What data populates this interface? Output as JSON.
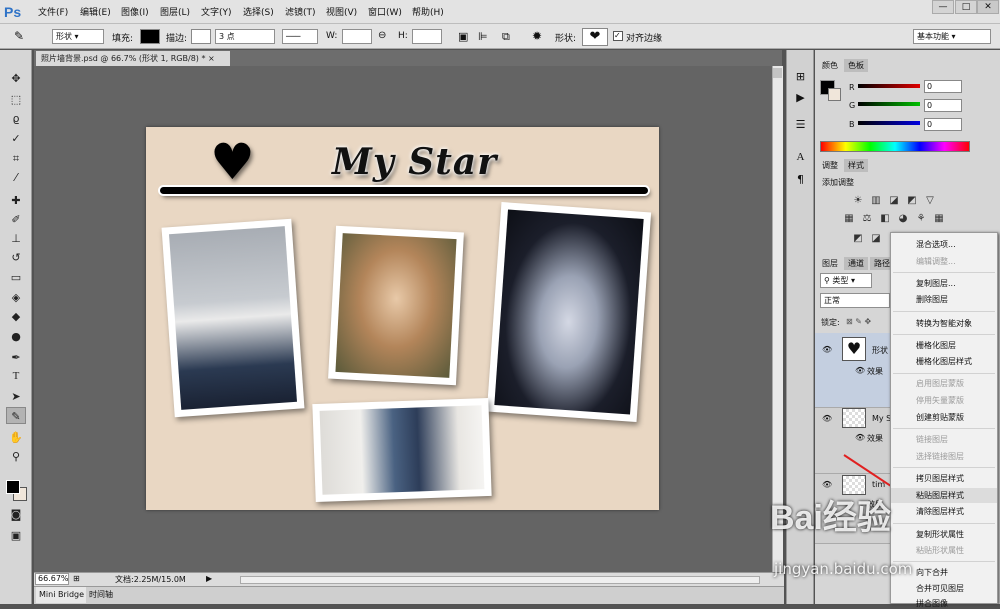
{
  "app": {
    "logo": "Ps",
    "window_controls": [
      "—",
      "□",
      "✕"
    ]
  },
  "menu": [
    "文件(F)",
    "编辑(E)",
    "图像(I)",
    "图层(L)",
    "文字(Y)",
    "选择(S)",
    "滤镜(T)",
    "视图(V)",
    "窗口(W)",
    "帮助(H)"
  ],
  "options": {
    "mode": "形状",
    "fill_label": "填充:",
    "stroke_label": "描边:",
    "stroke_width": "3 点",
    "w_label": "W:",
    "h_label": "H:",
    "shape_label": "形状:",
    "align_edges": "对齐边缘",
    "workspace": "基本功能"
  },
  "document": {
    "tab": "照片墙背景.psd @ 66.7% (形状 1, RGB/8) *",
    "title_text": "My Star",
    "zoom": "66.67%",
    "doc_size": "文档:2.25M/15.0M"
  },
  "bottom_tabs": [
    "Mini Bridge",
    "时间轴"
  ],
  "color_panel": {
    "tabs": [
      "颜色",
      "色板"
    ],
    "channels": [
      {
        "label": "R",
        "value": "0"
      },
      {
        "label": "G",
        "value": "0"
      },
      {
        "label": "B",
        "value": "0"
      }
    ]
  },
  "adjust_panel": {
    "tabs": [
      "调整",
      "样式"
    ],
    "add_label": "添加调整"
  },
  "layers_panel": {
    "tabs": [
      "图层",
      "通道",
      "路径"
    ],
    "filter": "类型",
    "blend": "正常",
    "lock_label": "锁定:",
    "layers": [
      {
        "name": "形状",
        "effect": "效果"
      },
      {
        "name": "My S",
        "effect": "效果"
      },
      {
        "name": "tim",
        "effect": "效果"
      }
    ]
  },
  "context_menu": {
    "items": [
      {
        "label": "混合选项...",
        "enabled": true
      },
      {
        "label": "编辑调整...",
        "enabled": false
      },
      {
        "label": "复制图层...",
        "enabled": true
      },
      {
        "label": "删除图层",
        "enabled": true
      },
      {
        "label": "转换为智能对象",
        "enabled": true
      },
      {
        "label": "栅格化图层",
        "enabled": true
      },
      {
        "label": "栅格化图层样式",
        "enabled": true
      },
      {
        "label": "启用图层蒙版",
        "enabled": false
      },
      {
        "label": "停用矢量蒙版",
        "enabled": false
      },
      {
        "label": "创建剪贴蒙版",
        "enabled": true
      },
      {
        "label": "链接图层",
        "enabled": false
      },
      {
        "label": "选择链接图层",
        "enabled": false
      },
      {
        "label": "拷贝图层样式",
        "enabled": true
      },
      {
        "label": "粘贴图层样式",
        "enabled": true,
        "highlighted": true
      },
      {
        "label": "清除图层样式",
        "enabled": true
      },
      {
        "label": "复制形状属性",
        "enabled": true
      },
      {
        "label": "粘贴形状属性",
        "enabled": false
      },
      {
        "label": "向下合并",
        "enabled": true
      },
      {
        "label": "合并可见图层",
        "enabled": true
      },
      {
        "label": "拼合图像",
        "enabled": true
      }
    ]
  },
  "watermark": {
    "text": "Bai经验",
    "url": "jingyan.baidu.com"
  },
  "colors": {
    "accent": "#2f73c7",
    "arrow": "#e02020"
  }
}
